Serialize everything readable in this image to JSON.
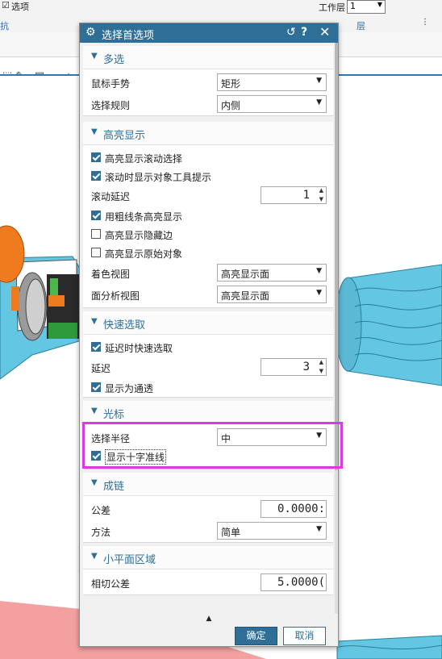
{
  "ribbon": {
    "options_label": "选项",
    "workspace_label": "工作层",
    "workspace_value": "1",
    "group_left": "抗",
    "group_layer": "层"
  },
  "dialog": {
    "title": "选择首选项",
    "sections": {
      "multi": {
        "name": "多选",
        "mouse_gesture_label": "鼠标手势",
        "mouse_gesture_value": "矩形",
        "select_rule_label": "选择规则",
        "select_rule_value": "内侧"
      },
      "highlight": {
        "name": "高亮显示",
        "cb_scroll_select": "高亮显示滚动选择",
        "cb_scroll_tooltip": "滚动时显示对象工具提示",
        "scroll_delay_label": "滚动延迟",
        "scroll_delay_value": "1",
        "cb_thick_lines": "用粗线条高亮显示",
        "cb_hidden_edges": "高亮显示隐藏边",
        "cb_original_objects": "高亮显示原始对象",
        "shaded_view_label": "着色视图",
        "shaded_view_value": "高亮显示面",
        "face_analysis_label": "面分析视图",
        "face_analysis_value": "高亮显示面"
      },
      "quickpick": {
        "name": "快速选取",
        "cb_delay_quick": "延迟时快速选取",
        "delay_label": "延迟",
        "delay_value": "3",
        "cb_show_passthrough": "显示为通透"
      },
      "cursor": {
        "name": "光标",
        "radius_label": "选择半径",
        "radius_value": "中",
        "cb_crosshair": "显示十字准线"
      },
      "chain": {
        "name": "成链",
        "tolerance_label": "公差",
        "tolerance_value": "0.0000:",
        "method_label": "方法",
        "method_value": "简单"
      },
      "facet": {
        "name": "小平面区域",
        "tangent_tol_label": "相切公差",
        "tangent_tol_value": "5.0000("
      }
    },
    "ok_label": "确定",
    "cancel_label": "取消"
  },
  "colors": {
    "accent": "#2f6f97",
    "highlight_box": "#d93be0",
    "model_cyan": "#63c6e2",
    "model_orange": "#f07a1e",
    "floor_pink": "#f4a0a0"
  }
}
